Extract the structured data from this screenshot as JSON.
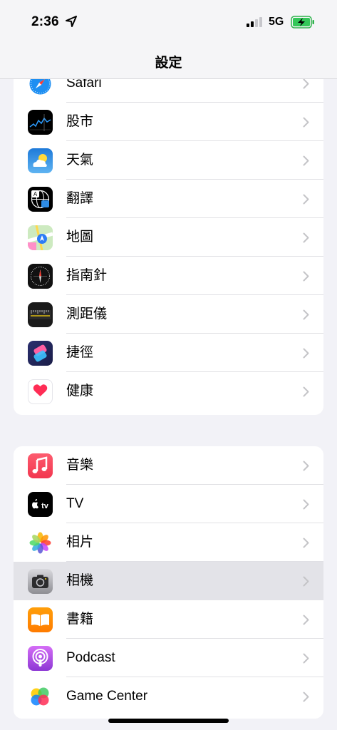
{
  "status_bar": {
    "time": "2:36",
    "network": "5G",
    "icons": [
      "location-arrow-icon",
      "signal-bars-icon",
      "battery-charging-icon"
    ]
  },
  "nav": {
    "title": "設定"
  },
  "group1": [
    {
      "label": "Safari",
      "icon": "safari-icon"
    },
    {
      "label": "股市",
      "icon": "stocks-icon"
    },
    {
      "label": "天氣",
      "icon": "weather-icon"
    },
    {
      "label": "翻譯",
      "icon": "translate-icon"
    },
    {
      "label": "地圖",
      "icon": "maps-icon"
    },
    {
      "label": "指南針",
      "icon": "compass-icon"
    },
    {
      "label": "測距儀",
      "icon": "measure-icon"
    },
    {
      "label": "捷徑",
      "icon": "shortcuts-icon"
    },
    {
      "label": "健康",
      "icon": "health-icon"
    }
  ],
  "group2": [
    {
      "label": "音樂",
      "icon": "music-icon"
    },
    {
      "label": "TV",
      "icon": "tv-icon"
    },
    {
      "label": "相片",
      "icon": "photos-icon"
    },
    {
      "label": "相機",
      "icon": "camera-icon",
      "highlighted": true
    },
    {
      "label": "書籍",
      "icon": "books-icon"
    },
    {
      "label": "Podcast",
      "icon": "podcast-icon"
    },
    {
      "label": "Game Center",
      "icon": "game-center-icon"
    }
  ],
  "colors": {
    "background": "#f2f2f7",
    "highlight": "#e3e3e8",
    "chevron": "#c4c4c7"
  }
}
